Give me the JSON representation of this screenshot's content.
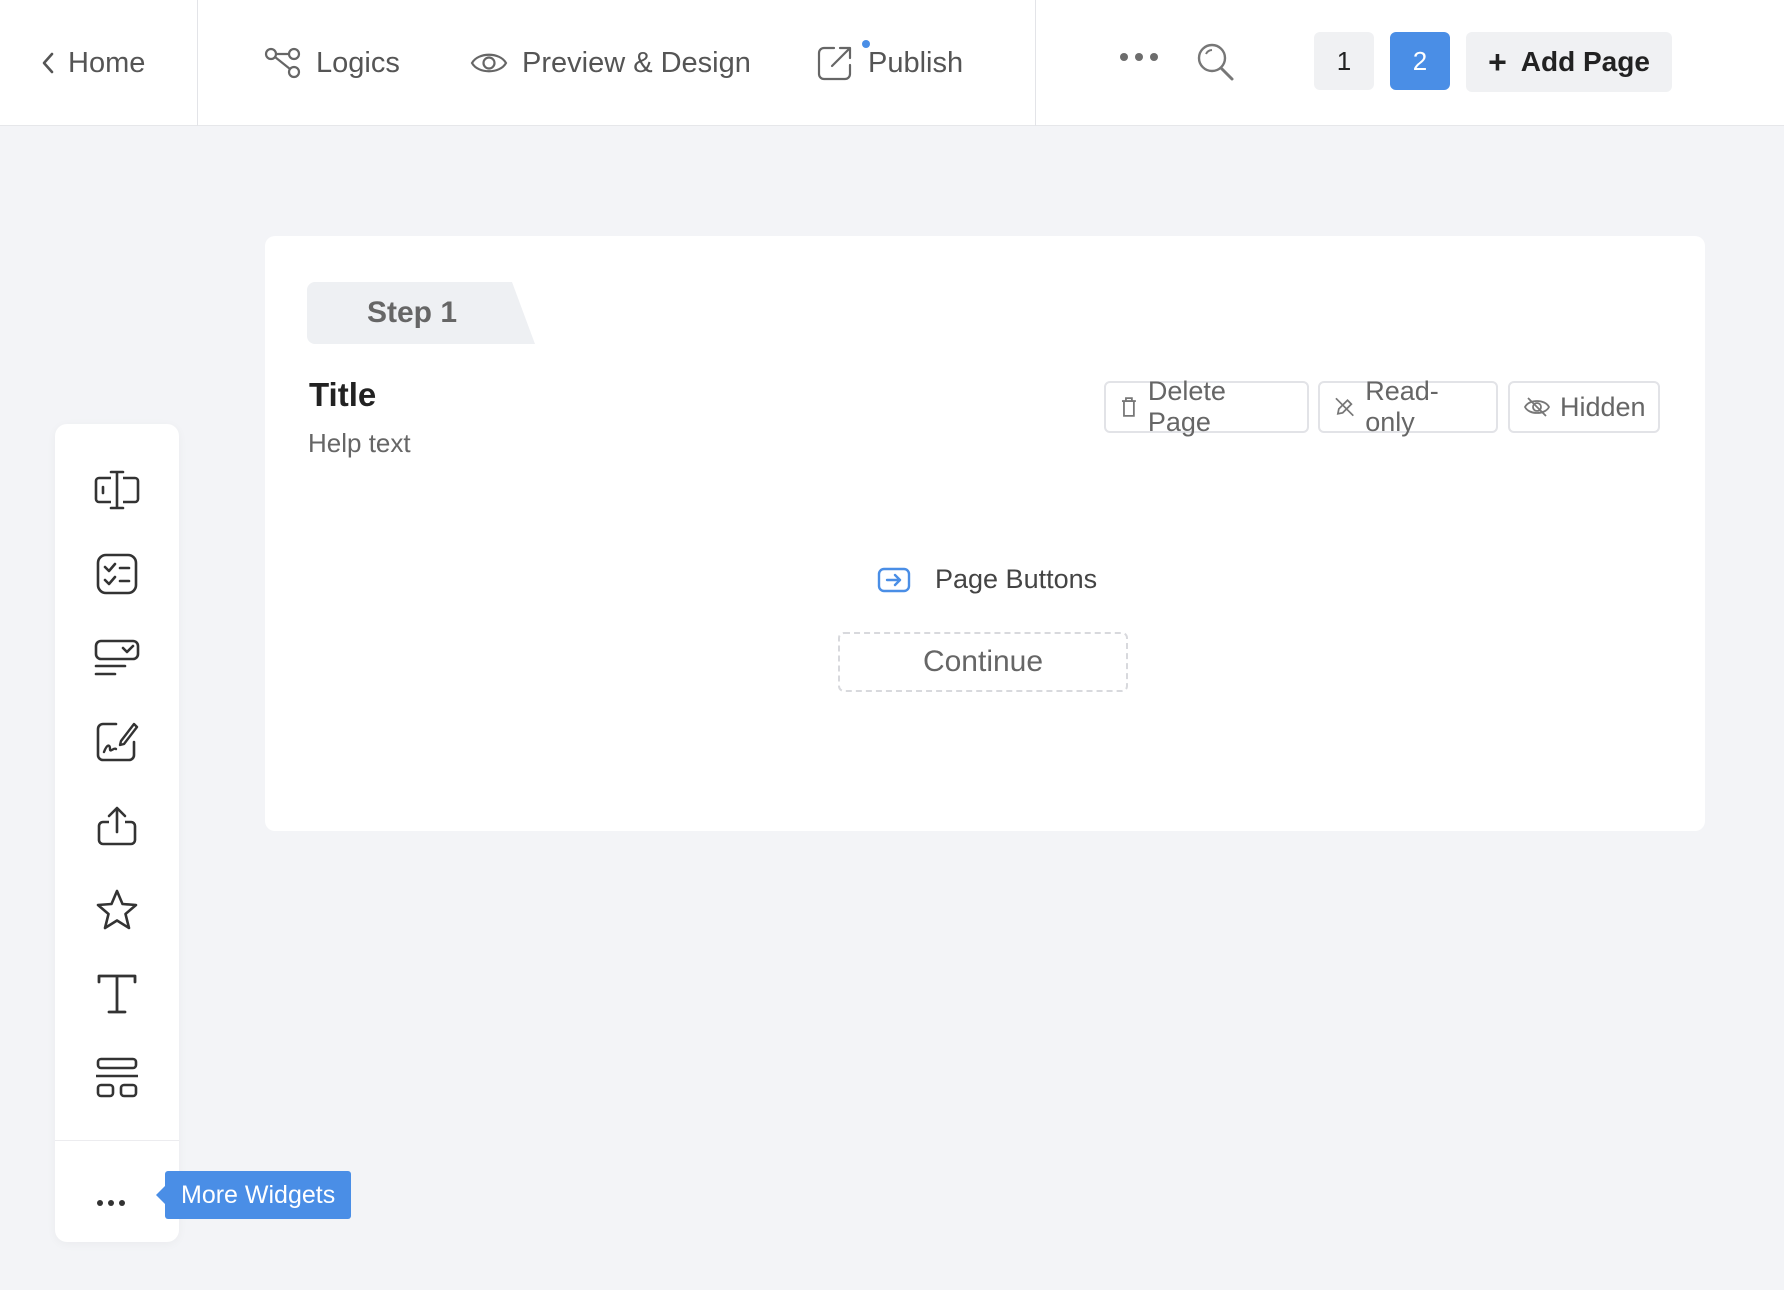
{
  "header": {
    "home_label": "Home",
    "logics_label": "Logics",
    "preview_label": "Preview & Design",
    "publish_label": "Publish",
    "pages": [
      "1",
      "2"
    ],
    "active_page": "2",
    "add_page_label": "Add Page"
  },
  "colors": {
    "accent": "#4a8ee6",
    "background": "#f3f4f7",
    "card": "#ffffff"
  },
  "step": {
    "tab_label": "Step 1",
    "title": "Title",
    "help_text": "Help text",
    "delete_label": "Delete Page",
    "readonly_label": "Read-only",
    "hidden_label": "Hidden",
    "page_buttons_label": "Page Buttons",
    "continue_label": "Continue"
  },
  "widgets": {
    "items": [
      "text-input-icon",
      "checklist-icon",
      "select-icon",
      "signature-icon",
      "upload-icon",
      "star-rating-icon",
      "text-icon",
      "layout-icon"
    ],
    "more_tooltip": "More Widgets"
  }
}
